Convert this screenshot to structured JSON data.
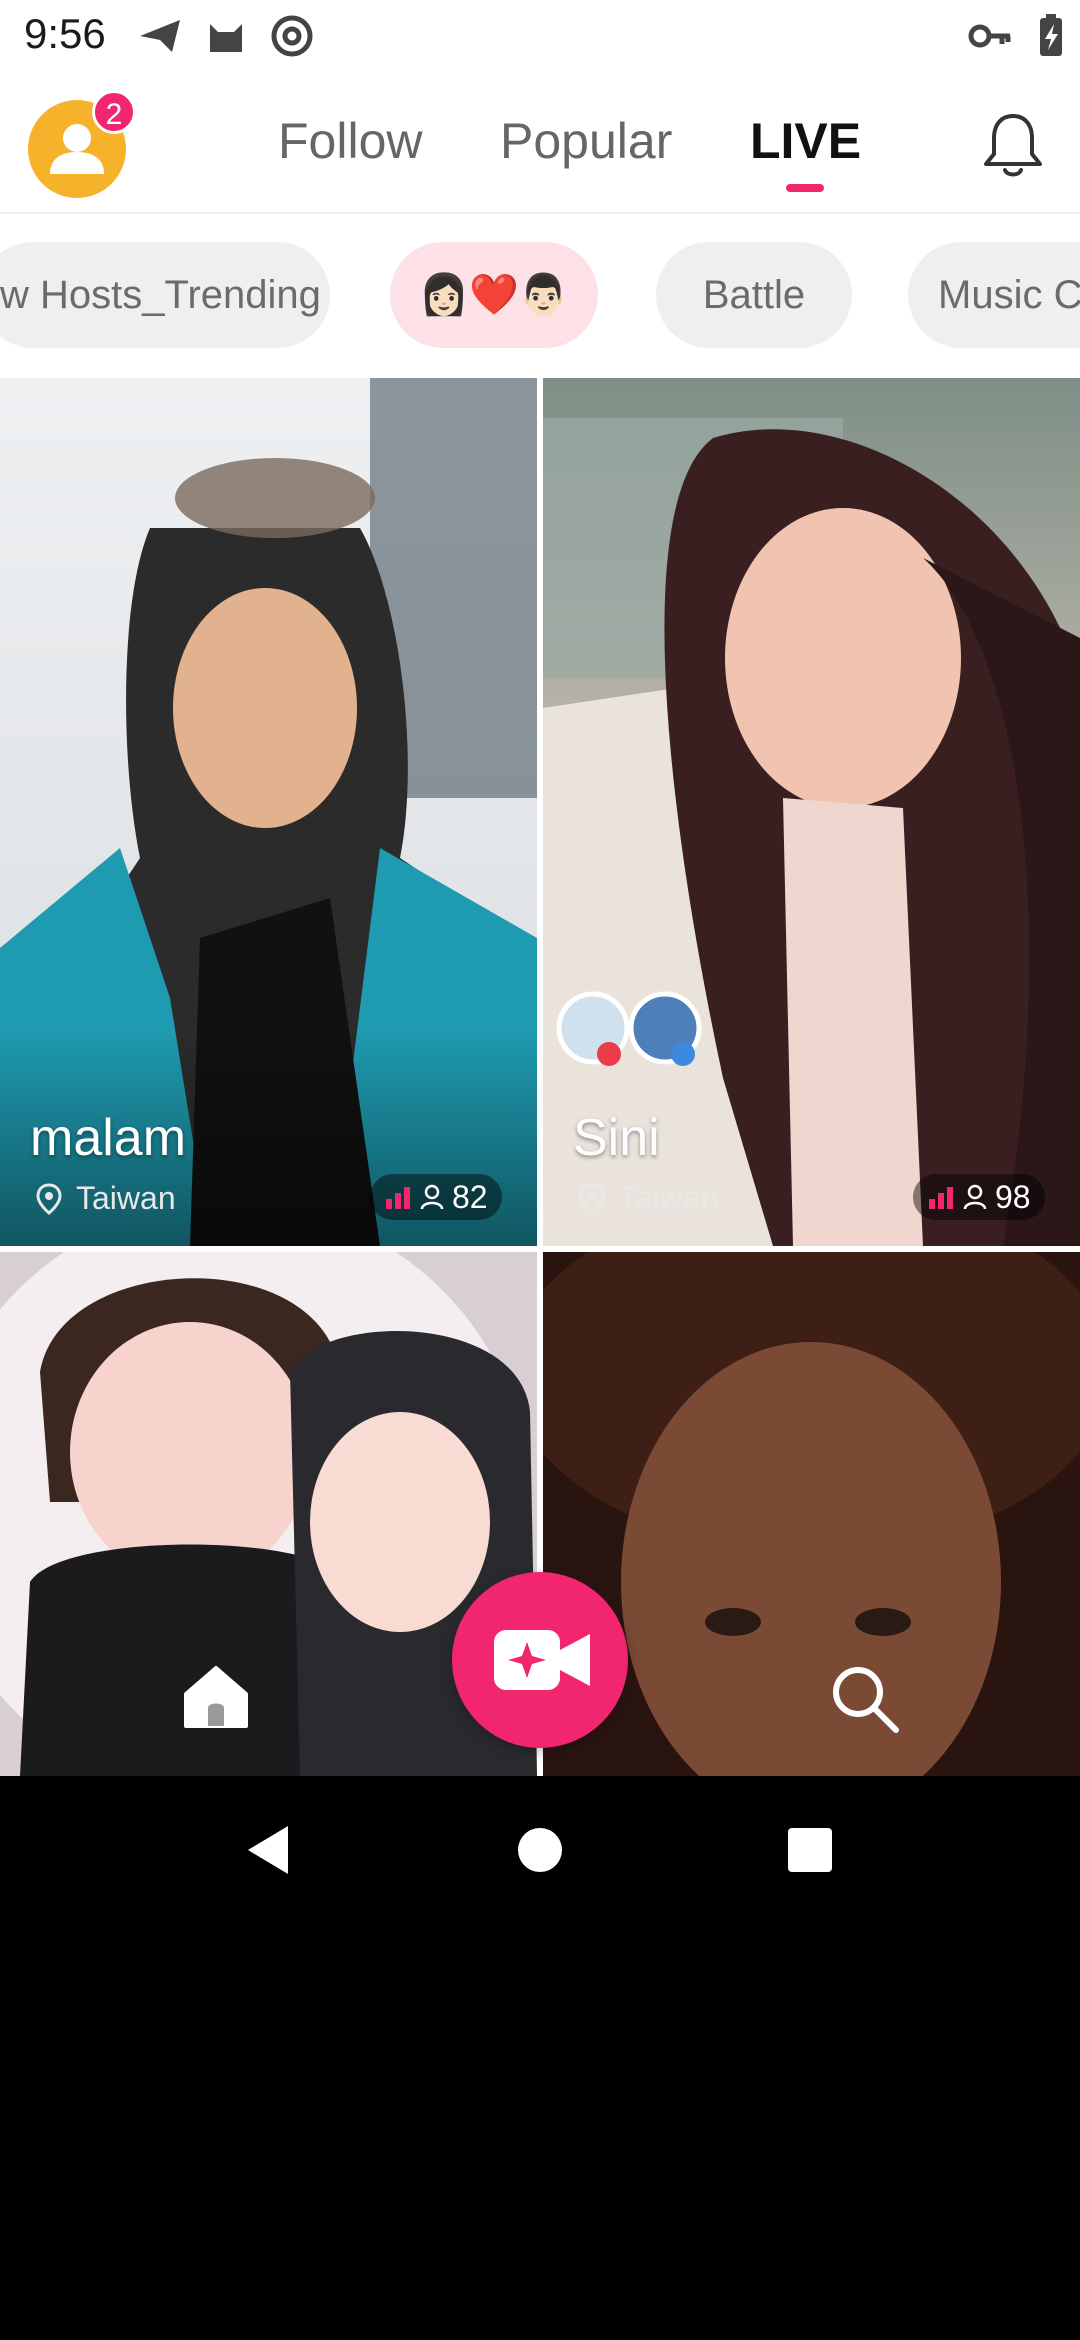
{
  "status_bar": {
    "time": "9:56"
  },
  "header": {
    "notification_count": "2",
    "tabs": [
      {
        "label": "Follow",
        "active": false
      },
      {
        "label": "Popular",
        "active": false
      },
      {
        "label": "LIVE",
        "active": true
      }
    ]
  },
  "chips": [
    {
      "label": "w Hosts_Trending"
    },
    {
      "label": "👩🏻❤️👨🏻"
    },
    {
      "label": "Battle"
    },
    {
      "label": "Music C"
    }
  ],
  "streams": [
    {
      "name": "malam",
      "location": "Taiwan",
      "viewers": "82"
    },
    {
      "name": "Sini",
      "location": "Taiwan",
      "viewers": "98"
    },
    {
      "name": "",
      "location": "",
      "viewers": ""
    },
    {
      "name": "",
      "location": "",
      "viewers": ""
    }
  ],
  "colors": {
    "accent": "#f1266f",
    "avatar": "#f6b22b"
  },
  "icons": {
    "status": [
      "send-icon",
      "cat-icon",
      "at-icon",
      "key-icon",
      "battery-charging-icon"
    ],
    "nav": [
      "home-icon",
      "live-camera-icon",
      "search-icon"
    ],
    "system": [
      "back-icon",
      "home-circle-icon",
      "recents-icon"
    ]
  }
}
